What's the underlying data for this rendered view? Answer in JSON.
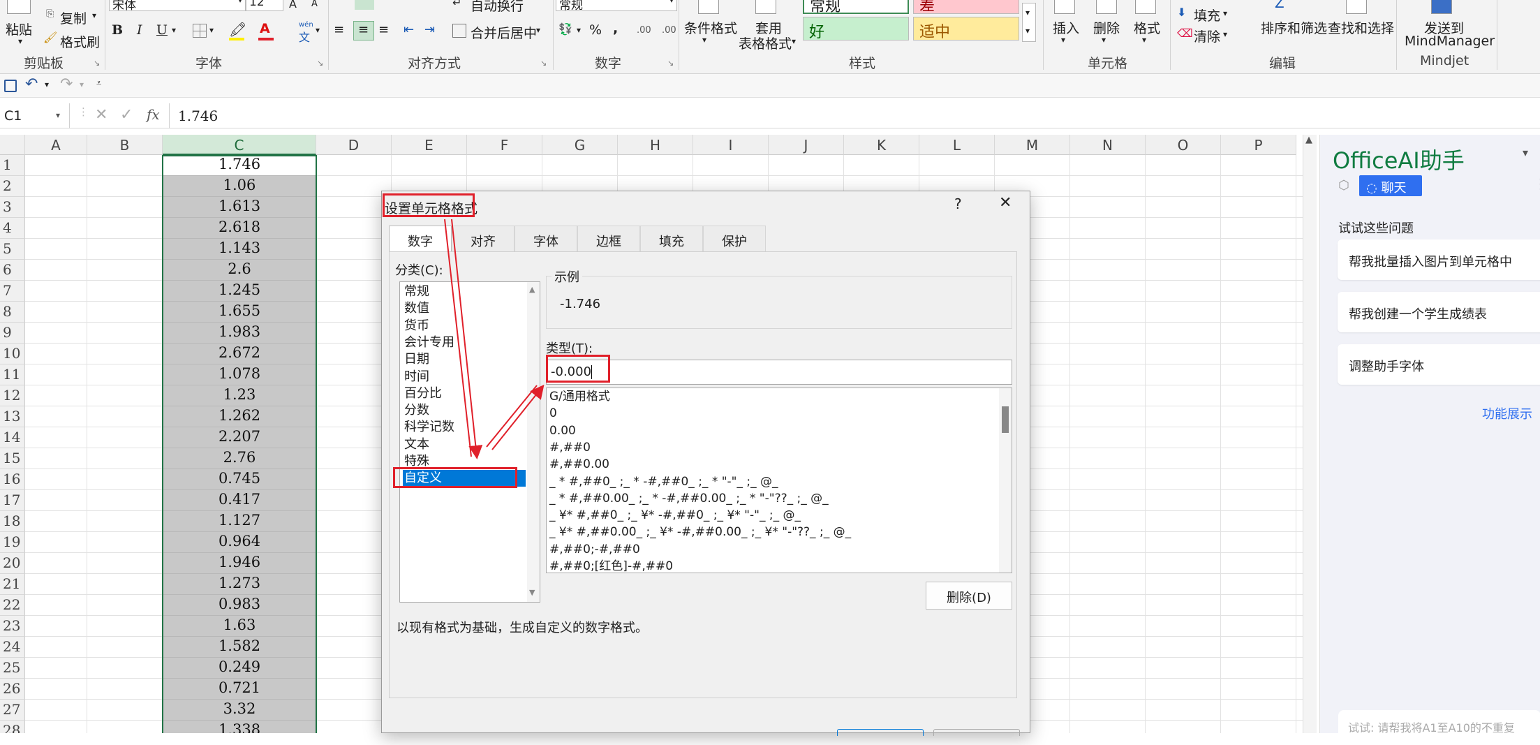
{
  "ribbon": {
    "clipboard": {
      "paste": "粘贴",
      "copy": "复制",
      "format_painter": "格式刷",
      "group": "剪贴板"
    },
    "font": {
      "name": "宋体",
      "size": "12",
      "bold": "B",
      "italic": "I",
      "underline": "U",
      "wen": "wén",
      "wen_char": "文",
      "group": "字体"
    },
    "alignment": {
      "wrap": "自动换行",
      "merge": "合并后居中",
      "group": "对齐方式"
    },
    "number": {
      "format": "常规",
      "percent": "%",
      "comma": ",",
      "inc_dec": ".00",
      "dec_dec": ".00",
      "group": "数字"
    },
    "styles": {
      "cond": "条件格式",
      "table": "套用",
      "table2": "表格格式",
      "normal": "常规",
      "bad": "差",
      "good": "好",
      "neutral": "适中",
      "group": "样式"
    },
    "cells": {
      "insert": "插入",
      "delete": "删除",
      "format": "格式",
      "group": "单元格"
    },
    "editing": {
      "fill": "填充",
      "clear": "清除",
      "sort": "排序和筛选",
      "find": "查找和选择",
      "group": "编辑"
    },
    "mindjet": {
      "send": "发送到",
      "mm": "MindManager",
      "group": "Mindjet"
    }
  },
  "formula_bar": {
    "cell_ref": "C1",
    "fx": "fx",
    "value": "1.746"
  },
  "grid": {
    "columns": [
      "A",
      "B",
      "C",
      "D",
      "E",
      "F",
      "G",
      "H",
      "I",
      "J",
      "K",
      "L",
      "M",
      "N",
      "O",
      "P"
    ],
    "rows": [
      "1",
      "2",
      "3",
      "4",
      "5",
      "6",
      "7",
      "8",
      "9",
      "10",
      "11",
      "12",
      "13",
      "14",
      "15",
      "16",
      "17",
      "18",
      "19",
      "20",
      "21",
      "22",
      "23",
      "24",
      "25",
      "26",
      "27",
      "28"
    ],
    "c_values": [
      "1.746",
      "1.06",
      "1.613",
      "2.618",
      "1.143",
      "2.6",
      "1.245",
      "1.655",
      "1.983",
      "2.672",
      "1.078",
      "1.23",
      "1.262",
      "2.207",
      "2.76",
      "0.745",
      "0.417",
      "1.127",
      "0.964",
      "1.946",
      "1.273",
      "0.983",
      "1.63",
      "1.582",
      "0.249",
      "0.721",
      "3.32",
      "1.338"
    ]
  },
  "assistant": {
    "title": "OfficeAI助手",
    "chat_tab": "聊天",
    "try_label": "试试这些问题",
    "suggestions": [
      "帮我批量插入图片到单元格中",
      "帮我创建一个学生成绩表",
      "调整助手字体"
    ],
    "feature_link": "功能展示",
    "input_placeholder": "试试: 请帮我将A1至A10的不重复"
  },
  "dialog": {
    "title": "设置单元格格式",
    "help": "?",
    "close": "✕",
    "tabs": [
      "数字",
      "对齐",
      "字体",
      "边框",
      "填充",
      "保护"
    ],
    "category_label": "分类(C):",
    "categories": [
      "常规",
      "数值",
      "货币",
      "会计专用",
      "日期",
      "时间",
      "百分比",
      "分数",
      "科学记数",
      "文本",
      "特殊",
      "自定义"
    ],
    "sample_label": "示例",
    "sample_value": "-1.746",
    "type_label": "类型(T):",
    "type_value": "-0.000",
    "formats": [
      "G/通用格式",
      "0",
      "0.00",
      "#,##0",
      "#,##0.00",
      "_ * #,##0_ ;_ * -#,##0_ ;_ * \"-\"_ ;_ @_",
      "_ * #,##0.00_ ;_ * -#,##0.00_ ;_ * \"-\"??_ ;_ @_",
      "_ ¥* #,##0_ ;_ ¥* -#,##0_ ;_ ¥* \"-\"_ ;_ @_",
      "_ ¥* #,##0.00_ ;_ ¥* -#,##0.00_ ;_ ¥* \"-\"??_ ;_ @_",
      "#,##0;-#,##0",
      "#,##0;[红色]-#,##0"
    ],
    "delete_button": "删除(D)",
    "description": "以现有格式为基础，生成自定义的数字格式。"
  },
  "colors": {
    "selection_green": "#217346",
    "highlight_red": "#e0202a",
    "selected_blue": "#0078d7",
    "accent_green": "#107c41"
  }
}
